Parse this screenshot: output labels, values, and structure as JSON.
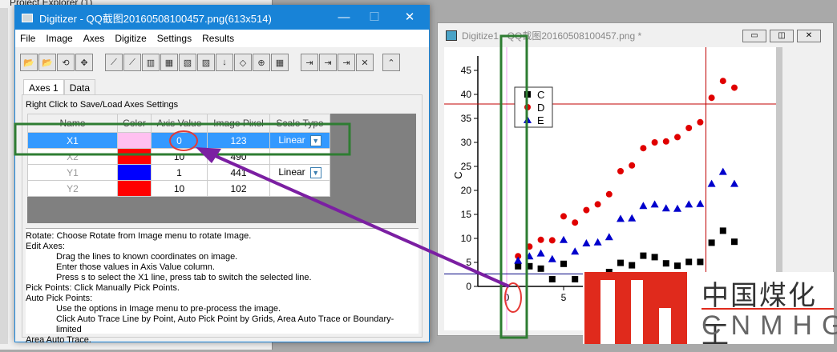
{
  "background_panel": {
    "title": "Project Explorer (1)"
  },
  "digitizer": {
    "title": "Digitizer - QQ截图20160508100457.png(613x514)",
    "controls": {
      "minimize": "—",
      "maximize": "☐",
      "close": "✕"
    },
    "menu": [
      "File",
      "Image",
      "Axes",
      "Digitize",
      "Settings",
      "Results"
    ],
    "toolbar_icons": [
      "open-folder-icon",
      "open-color-folder-icon",
      "rotate-icon",
      "move-icon",
      "edit-axes-icon",
      "pick-points-icon",
      "auto-trace-icon",
      "grid-pick-icon",
      "area-trace-icon",
      "boundary-trace-icon",
      "sort-icon",
      "tag-icon",
      "add-point-icon",
      "remove-grid-icon",
      "go-to-data-icon",
      "go-to-graph-icon",
      "go-to-peaks-icon",
      "delete-icon",
      "collapse-icon"
    ],
    "tabs": [
      "Axes 1",
      "Data"
    ],
    "hint": "Right Click to Save/Load Axes Settings",
    "columns": [
      "Name",
      "Color",
      "Axis Value",
      "Image Pixel",
      "Scale Type"
    ],
    "rows": [
      {
        "name": "X1",
        "color": "#ffc0f0",
        "axis_value": "0",
        "image_pixel": "123",
        "scale": "Linear"
      },
      {
        "name": "X2",
        "color": "#ff0000",
        "axis_value": "10",
        "image_pixel": "490",
        "scale": ""
      },
      {
        "name": "Y1",
        "color": "#0000ff",
        "axis_value": "1",
        "image_pixel": "441",
        "scale": "Linear"
      },
      {
        "name": "Y2",
        "color": "#ff0000",
        "axis_value": "10",
        "image_pixel": "102",
        "scale": ""
      }
    ],
    "help": [
      {
        "t": "Rotate: Choose Rotate from Image menu to rotate Image.",
        "indent": false
      },
      {
        "t": "Edit Axes:",
        "indent": false
      },
      {
        "t": "Drag the lines to known coordinates on image.",
        "indent": true
      },
      {
        "t": "Enter those values in Axis Value column.",
        "indent": true
      },
      {
        "t": "Press s to select the X1 line, press tab to switch the selected line.",
        "indent": true
      },
      {
        "t": "Pick Points: Click Manually Pick Points.",
        "indent": false
      },
      {
        "t": "Auto Pick Points:",
        "indent": false
      },
      {
        "t": "Use the options in Image menu to pre-process the image.",
        "indent": true
      },
      {
        "t": "Click Auto Trace Line by Point, Auto Pick Point by Grids, Area Auto Trace or Boundary-limited",
        "indent": true
      },
      {
        "t": "Area Auto Trace.",
        "indent": false
      }
    ]
  },
  "plot_window": {
    "title": "Digitize1 - QQ截图20160508100457.png *",
    "controls": {
      "minimize": "▭",
      "restore": "◫",
      "close": "✕"
    }
  },
  "chart_data": {
    "type": "scatter",
    "ylabel": "C",
    "xlim": [
      -2,
      23
    ],
    "ylim": [
      0,
      48
    ],
    "yticks": [
      0,
      5,
      10,
      15,
      20,
      25,
      30,
      35,
      40,
      45
    ],
    "xticks": [
      0,
      5
    ],
    "legend": {
      "position": "top-left",
      "entries": [
        "C",
        "D",
        "E"
      ]
    },
    "x": [
      1,
      2,
      3,
      4,
      5,
      6,
      7,
      8,
      9,
      10,
      11,
      12,
      13,
      14,
      15,
      16,
      17,
      18,
      19,
      20
    ],
    "series": [
      {
        "name": "C",
        "color": "#000000",
        "marker": "square",
        "values": [
          4.2,
          4.2,
          3.7,
          1.5,
          4.7,
          1.5,
          2,
          2,
          3,
          4.9,
          4.4,
          6.4,
          6.1,
          4.8,
          4.3,
          5.1,
          5.1,
          9.1,
          11.6,
          9.3
        ]
      },
      {
        "name": "D",
        "color": "#e00000",
        "marker": "circle",
        "values": [
          6.3,
          8.3,
          9.7,
          9.6,
          14.6,
          13.3,
          15.9,
          17.1,
          19.2,
          24,
          25.2,
          28.8,
          30,
          30.2,
          31.1,
          33,
          34.2,
          39.3,
          42.8,
          41.4
        ]
      },
      {
        "name": "E",
        "color": "#0000cc",
        "marker": "triangle",
        "values": [
          5.4,
          6.3,
          6.9,
          5.7,
          9.7,
          7.3,
          9,
          9.2,
          10.3,
          14.1,
          14.2,
          16.8,
          17.1,
          16.3,
          16.2,
          17.1,
          17.2,
          21.4,
          23.9,
          21.4
        ]
      }
    ],
    "guide_lines": {
      "x1": 0,
      "x2": 17.5,
      "y1": 2.6,
      "y2": 38
    }
  },
  "watermark": {
    "chinese": "中国煤化工",
    "latin": "CNMHG",
    "mark": "MH"
  }
}
